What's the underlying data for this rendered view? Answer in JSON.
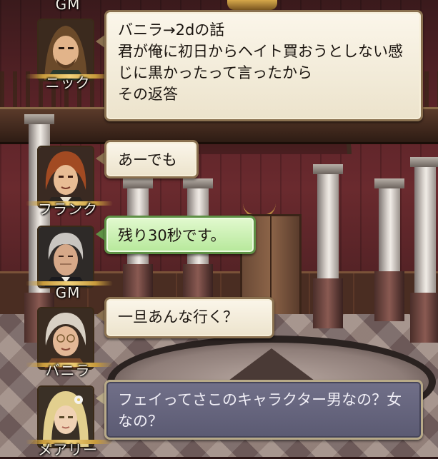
{
  "chat": {
    "top_name": "GM",
    "messages": [
      {
        "speaker": "ニック",
        "text": "バニラ→2dの話\n君が俺に初日からヘイト買おうとしない感じに黒かったって言ったから\nその返答",
        "style": "cream",
        "portrait": "long-haired-bearded-man"
      },
      {
        "speaker": "フランク",
        "text": "あーでも",
        "style": "cream",
        "portrait": "curly-red-haired-man"
      },
      {
        "speaker": "GM",
        "text": "残り30秒です。",
        "style": "green",
        "portrait": "elderly-butler"
      },
      {
        "speaker": "バニラ",
        "text": "一旦あんな行く？",
        "style": "cream",
        "portrait": "elderly-woman-glasses"
      },
      {
        "speaker": "メアリー",
        "text": "フェイってさこのキャラクター男なの？女なの？",
        "style": "slate",
        "portrait": "blonde-woman-flower"
      }
    ]
  },
  "colors": {
    "bubble_cream": "#fbf6ea",
    "bubble_green": "#c9f0b0",
    "bubble_slate": "#66657e",
    "name_text": "#f3efe6",
    "gold_trim": "#c89b3c"
  }
}
